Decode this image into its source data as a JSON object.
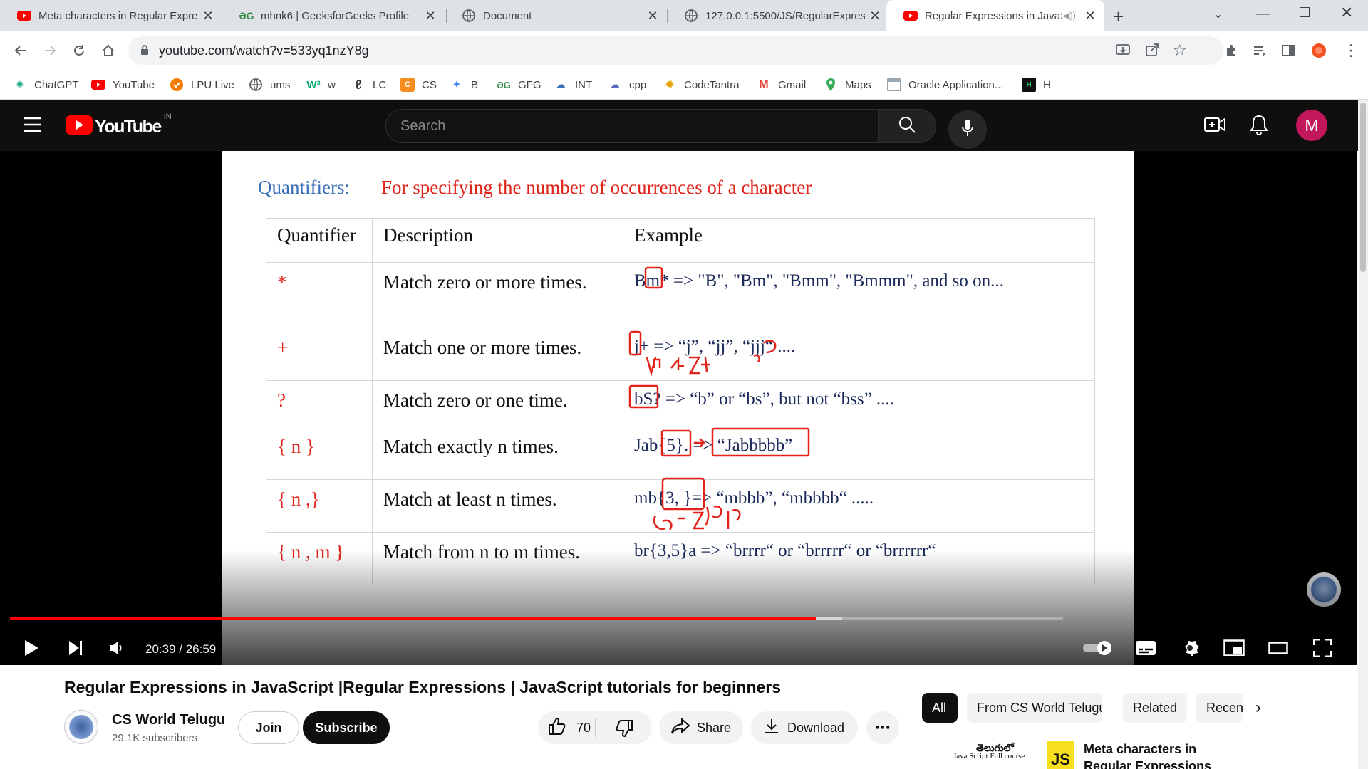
{
  "browser": {
    "tabs": [
      {
        "title": "Meta characters in Regular Expre",
        "favicon": "youtube-icon",
        "active": false
      },
      {
        "title": "mhnk6 | GeeksforGeeks Profile",
        "favicon": "gfg-icon",
        "active": false
      },
      {
        "title": "Document",
        "favicon": "globe-icon",
        "active": false
      },
      {
        "title": "127.0.0.1:5500/JS/RegularExpres",
        "favicon": "globe-icon",
        "active": false
      },
      {
        "title": "Regular Expressions in JavaS",
        "favicon": "youtube-icon",
        "active": true
      }
    ],
    "url": "youtube.com/watch?v=533yq1nzY8g",
    "bookmarks": [
      {
        "label": "ChatGPT",
        "icon": "chatgpt-icon"
      },
      {
        "label": "YouTube",
        "icon": "youtube-icon"
      },
      {
        "label": "LPU Live",
        "icon": "lpu-icon"
      },
      {
        "label": "ums",
        "icon": "globe-icon"
      },
      {
        "label": "w",
        "icon": "w3-icon"
      },
      {
        "label": "LC",
        "icon": "leetcode-icon"
      },
      {
        "label": "CS",
        "icon": "codestudio-icon"
      },
      {
        "label": "B",
        "icon": "bard-icon"
      },
      {
        "label": "GFG",
        "icon": "gfg-icon"
      },
      {
        "label": "INT",
        "icon": "cloud-icon"
      },
      {
        "label": "cpp",
        "icon": "cpp-icon"
      },
      {
        "label": "CodeTantra",
        "icon": "codetantra-icon"
      },
      {
        "label": "Gmail",
        "icon": "gmail-icon"
      },
      {
        "label": "Maps",
        "icon": "maps-icon"
      },
      {
        "label": "Oracle Application...",
        "icon": "oracle-icon"
      },
      {
        "label": "H",
        "icon": "hackerrank-icon"
      }
    ]
  },
  "youtube": {
    "logo_text": "YouTube",
    "country_code": "IN",
    "search_placeholder": "Search",
    "avatar_letter": "M",
    "avatar_color": "#c2185b",
    "brand_red": "#ff0000"
  },
  "slide": {
    "title": "Quantifiers:",
    "subtitle": "For specifying the number of occurrences of a character",
    "headers": [
      "Quantifier",
      "Description",
      "Example"
    ],
    "rows": [
      {
        "q": "*",
        "d": "Match zero or more times.",
        "e": "Bm* => \"B\", \"Bm\", \"Bmm\", \"Bmmm\", and so on..."
      },
      {
        "q": "+",
        "d": "Match one or more times.",
        "e": "j+ => “j”, “jj”, “jjj“ ...."
      },
      {
        "q": "?",
        "d": "Match zero or one time.",
        "e": "bS? => “b” or “bs”, but not “bss” ...."
      },
      {
        "q": "{ n }",
        "d": "Match exactly n times.",
        "e": "Jab{5}. => “Jabbbbb”"
      },
      {
        "q": "{ n ,}",
        "d": "Match at least n times.",
        "e": "mb{3, }=> “mbbb”, “mbbbb“ ....."
      },
      {
        "q": "{ n , m }",
        "d": "Match from n to m times.",
        "e": "br{3,5}a => “brrrr“ or “brrrrr“ or “brrrrrr“"
      }
    ],
    "title_color": "#3a6fb7",
    "accent_color": "#e2231a"
  },
  "player": {
    "current_time": "20:39",
    "duration": "26:59",
    "time_display": "20:39 / 26:59",
    "progress_fraction": 0.7649,
    "buffered_fraction": 0.79
  },
  "video": {
    "title": "Regular Expressions in JavaScript |Regular Expressions | JavaScript tutorials for beginners",
    "channel": "CS World Telugu",
    "subscribers": "29.1K subscribers",
    "join_label": "Join",
    "subscribe_label": "Subscribe",
    "likes": "70",
    "share_label": "Share",
    "download_label": "Download"
  },
  "sidebar": {
    "chips": [
      "All",
      "From CS World Telugu",
      "Related",
      "Recen"
    ],
    "rec_title": "Meta characters in Regular Expressions |Regular",
    "rec_thumb_text": "తెలుగులో",
    "rec_thumb_sub": "Java Script Full course",
    "rec_thumb_badge": "JS"
  }
}
